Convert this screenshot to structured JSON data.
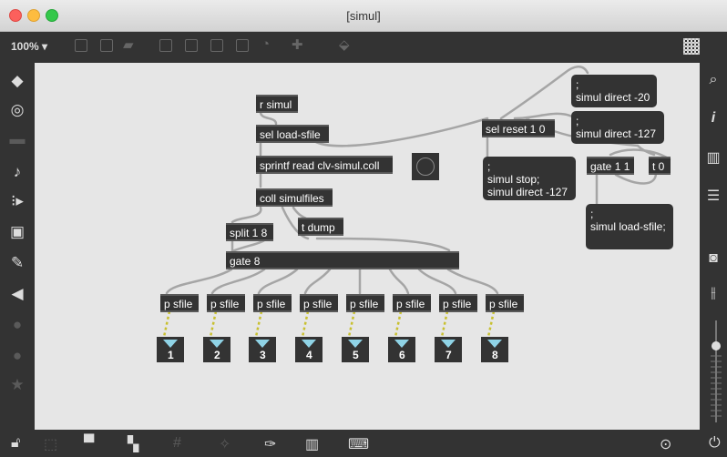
{
  "window": {
    "title": "[simul]"
  },
  "toolbar": {
    "zoom": "100% ▾"
  },
  "left_sidebar": [
    "cube-icon",
    "target-icon",
    "film-icon",
    "music-note-icon",
    "playlist-icon",
    "image-icon",
    "paperclip-icon",
    "plug-icon",
    "vst-icon",
    "plugin-icon",
    "star-icon"
  ],
  "right_sidebar": [
    "search-icon",
    "info-icon",
    "columns-icon",
    "list-icon",
    "camera-icon",
    "mixer-icon"
  ],
  "bottom_bar": [
    "lock-icon",
    "presentation-icon",
    "comment-icon",
    "layers-icon",
    "grid-icon",
    "snap-icon",
    "wrench-icon",
    "piano-icon",
    "keyboard-icon",
    "play-icon",
    "power-icon"
  ],
  "objects": {
    "r_simul": "r simul",
    "sel_load": "sel load-sfile",
    "sprintf": "sprintf read clv-simul.coll",
    "coll": "coll simulfiles",
    "t_dump": "t dump",
    "split": "split 1 8",
    "gate8": "gate 8",
    "sel_reset": "sel reset 1 0",
    "gate11": "gate 1 1",
    "t0": "t 0",
    "psfile": [
      "p sfile",
      "p sfile",
      "p sfile",
      "p sfile",
      "p sfile",
      "p sfile",
      "p sfile",
      "p sfile"
    ]
  },
  "messages": {
    "direct20": ";\nsimul direct -20",
    "direct127": ";\nsimul direct -127",
    "stop": ";\nsimul stop;\nsimul direct -127",
    "load": ";\nsimul load-sfile;"
  },
  "numbers": [
    "1",
    "2",
    "3",
    "4",
    "5",
    "6",
    "7",
    "8"
  ],
  "colors": {
    "canvas": "#e6e6e6",
    "object": "#333333",
    "inlet": "#9aa832",
    "cord": "#a5a5a5",
    "number_triangle": "#8fd3e6"
  }
}
